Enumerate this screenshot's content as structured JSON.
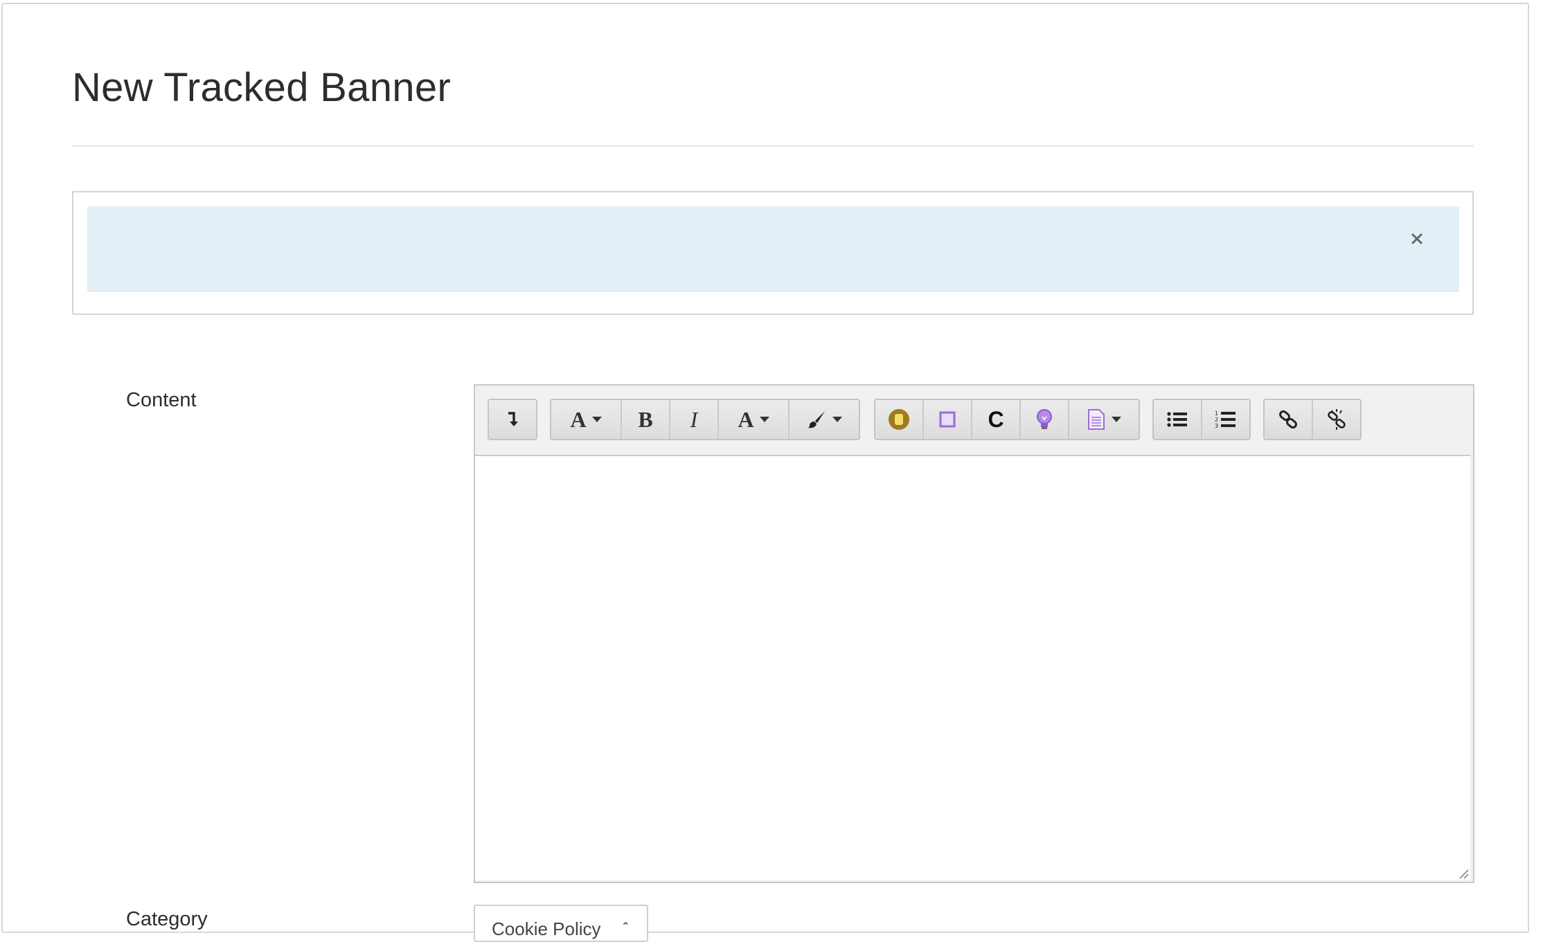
{
  "page": {
    "title": "New Tracked Banner"
  },
  "banner_preview": {
    "close_glyph": "×",
    "background_color": "#e2eff6"
  },
  "form": {
    "content_label": "Content",
    "category_label": "Category",
    "category_select": {
      "selected": "Cookie Policy",
      "caret_glyph": "⌃"
    }
  },
  "toolbar": {
    "groups": [
      {
        "buttons": [
          {
            "name": "source-toggle",
            "glyph": "↴",
            "icon": "arrow-down-icon"
          }
        ]
      },
      {
        "buttons": [
          {
            "name": "font-size",
            "glyph": "A",
            "icon": "font-size-icon",
            "dropdown": true
          },
          {
            "name": "bold",
            "glyph": "B",
            "icon": "bold-icon"
          },
          {
            "name": "italic",
            "glyph": "I",
            "icon": "italic-icon"
          },
          {
            "name": "font-color",
            "glyph": "A",
            "icon": "font-color-icon",
            "dropdown": true
          },
          {
            "name": "style-brush",
            "glyph": "",
            "icon": "paintbrush-icon",
            "dropdown": true
          }
        ]
      },
      {
        "buttons": [
          {
            "name": "widget-gold",
            "icon": "gold-coin-icon"
          },
          {
            "name": "widget-box",
            "icon": "purple-box-icon"
          },
          {
            "name": "widget-c",
            "glyph": "C",
            "icon": "letter-c-icon"
          },
          {
            "name": "widget-tip",
            "icon": "lightbulb-icon"
          },
          {
            "name": "widget-template",
            "icon": "document-icon",
            "dropdown": true
          }
        ]
      },
      {
        "buttons": [
          {
            "name": "bullet-list",
            "icon": "bullet-list-icon"
          },
          {
            "name": "numbered-list",
            "icon": "numbered-list-icon"
          }
        ]
      },
      {
        "buttons": [
          {
            "name": "link",
            "icon": "link-icon"
          },
          {
            "name": "unlink",
            "icon": "unlink-icon"
          }
        ]
      }
    ],
    "colors": {
      "gold": "#a07a1c",
      "purple": "#9b6bd6"
    }
  }
}
